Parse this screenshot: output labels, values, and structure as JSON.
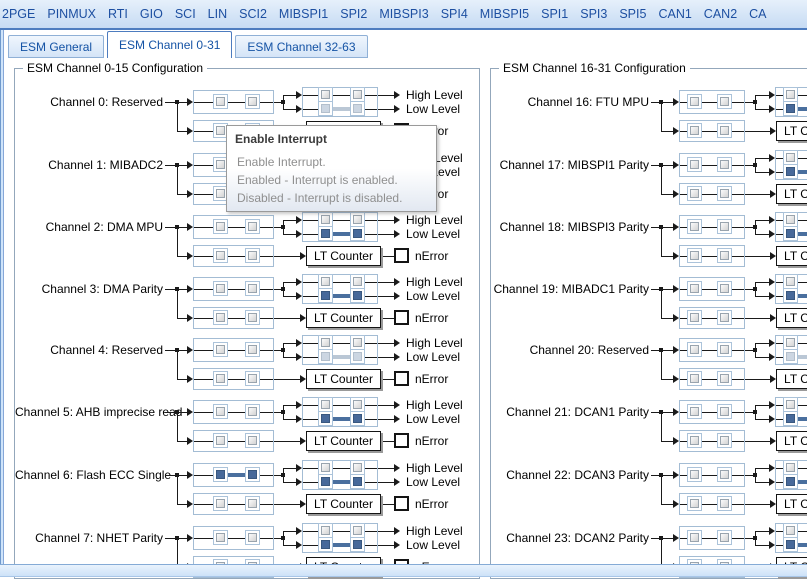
{
  "top_tabs": [
    "2PGE",
    "PINMUX",
    "RTI",
    "GIO",
    "SCI",
    "LIN",
    "SCI2",
    "MIBSPI1",
    "SPI2",
    "MIBSPI3",
    "SPI4",
    "MIBSPI5",
    "SPI1",
    "SPI3",
    "SPI5",
    "CAN1",
    "CAN2",
    "CA"
  ],
  "sub_tabs": [
    {
      "label": "ESM General",
      "selected": false
    },
    {
      "label": "ESM Channel 0-31",
      "selected": true
    },
    {
      "label": "ESM Channel 32-63",
      "selected": false
    }
  ],
  "diagram_labels": {
    "high": "High Level",
    "low": "Low Level",
    "lt_counter": "LT Counter",
    "nerror": "nError"
  },
  "groups": [
    {
      "title": "ESM Channel 0-15 Configuration",
      "side": "left",
      "channels": [
        {
          "label": "Channel 0: Reserved",
          "reserved": true,
          "interrupt_checked": false
        },
        {
          "label": "Channel 1: MIBADC2",
          "reserved": false,
          "interrupt_checked": false
        },
        {
          "label": "Channel 2: DMA MPU",
          "reserved": false,
          "interrupt_checked": false
        },
        {
          "label": "Channel 3: DMA Parity",
          "reserved": false,
          "interrupt_checked": false
        },
        {
          "label": "Channel 4: Reserved",
          "reserved": true,
          "interrupt_checked": false
        },
        {
          "label": "Channel 5: AHB imprecise read",
          "reserved": false,
          "interrupt_checked": false
        },
        {
          "label": "Channel 6: Flash ECC Single",
          "reserved": false,
          "interrupt_checked": true
        },
        {
          "label": "Channel 7: NHET Parity",
          "reserved": false,
          "interrupt_checked": false
        }
      ]
    },
    {
      "title": "ESM Channel 16-31 Configuration",
      "side": "right",
      "channels": [
        {
          "label": "Channel 16: FTU MPU",
          "reserved": false,
          "interrupt_checked": false
        },
        {
          "label": "Channel 17: MIBSPI1 Parity",
          "reserved": false,
          "interrupt_checked": false
        },
        {
          "label": "Channel 18: MIBSPI3 Parity",
          "reserved": false,
          "interrupt_checked": false
        },
        {
          "label": "Channel 19: MIBADC1 Parity",
          "reserved": false,
          "interrupt_checked": false
        },
        {
          "label": "Channel 20: Reserved",
          "reserved": true,
          "interrupt_checked": false
        },
        {
          "label": "Channel 21: DCAN1 Parity",
          "reserved": false,
          "interrupt_checked": false
        },
        {
          "label": "Channel 22: DCAN3 Parity",
          "reserved": false,
          "interrupt_checked": false
        },
        {
          "label": "Channel 23: DCAN2 Parity",
          "reserved": false,
          "interrupt_checked": false
        }
      ]
    }
  ],
  "tooltip": {
    "title": "Enable Interrupt",
    "lines": [
      "Enable Interrupt.",
      "Enabled - Interrupt is enabled.",
      "Disabled - Interrupt is disabled."
    ]
  },
  "colors": {
    "tab_text": "#1d4fa1",
    "tab_strip_line": "#4d7cbf",
    "group_border": "#93a7bb",
    "box_border": "#a3bcd4",
    "wire": "#1a1a1a",
    "checked_fill": "#47699a",
    "checked_fill_disabled": "#ccd6e2",
    "wire_thick": "#4a6f9e",
    "wire_thick_disabled": "#bac7d5",
    "tooltip_text": "#8f8f8f"
  }
}
